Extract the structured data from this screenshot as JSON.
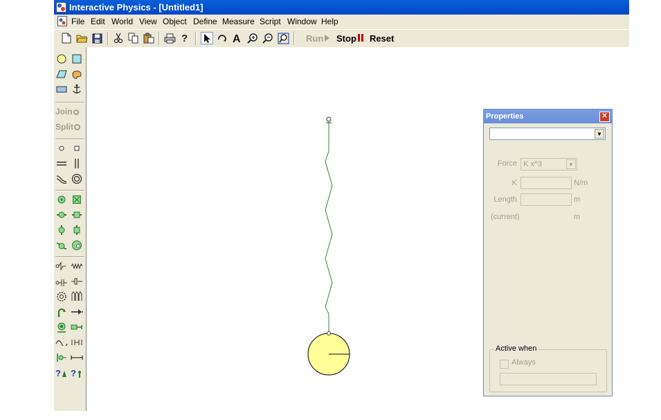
{
  "window": {
    "title": "Interactive Physics - [Untitled1]"
  },
  "menubar": {
    "items": [
      "File",
      "Edit",
      "World",
      "View",
      "Object",
      "Define",
      "Measure",
      "Script",
      "Window",
      "Help"
    ]
  },
  "toolbar": {
    "run_label": "Run",
    "stop_label": "Stop",
    "reset_label": "Reset"
  },
  "palette": {
    "join_label": "Join",
    "split_label": "Split"
  },
  "properties": {
    "title": "Properties",
    "selector_value": "",
    "force_label": "Force",
    "force_value": "K x^3",
    "k_label": "K",
    "k_value": "",
    "k_unit": "N/m",
    "length_label": "Length",
    "length_value": "",
    "length_unit": "m",
    "current_label": "(current)",
    "current_unit": "m",
    "active_when_label": "Active when",
    "always_label": "Always",
    "always_checked": false
  },
  "colors": {
    "titlebar": "#0047c8",
    "spring": "#2e8b2e",
    "ball_fill": "#ffff99",
    "stop_accent": "#c00000"
  }
}
